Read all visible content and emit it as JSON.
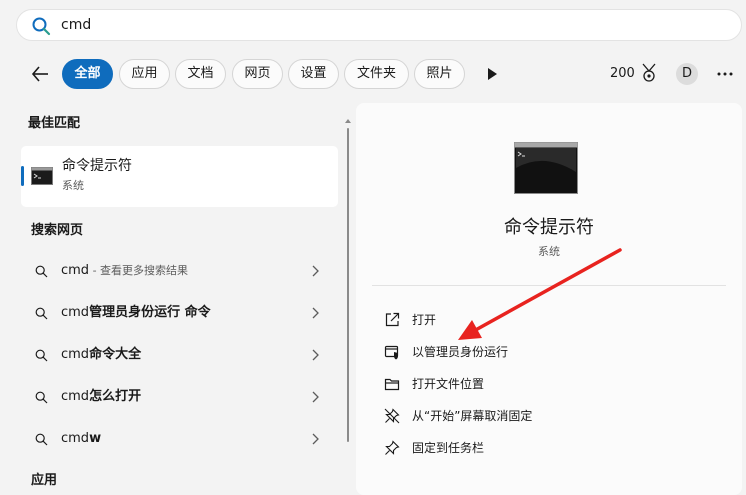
{
  "search": {
    "query": "cmd"
  },
  "filters": {
    "tabs": [
      {
        "label": "全部",
        "active": true
      },
      {
        "label": "应用"
      },
      {
        "label": "文档"
      },
      {
        "label": "网页"
      },
      {
        "label": "设置"
      },
      {
        "label": "文件夹"
      },
      {
        "label": "照片"
      }
    ],
    "points": "200",
    "avatar_letter": "D"
  },
  "results": {
    "best_match_header": "最佳匹配",
    "best_match": {
      "title": "命令提示符",
      "subtitle": "系统",
      "icon": "command-prompt-icon"
    },
    "web_header": "搜索网页",
    "web_items": [
      {
        "main": "cmd",
        "hint": " - 查看更多搜索结果"
      },
      {
        "main": "cmd",
        "bold": "管理员身份运行 命令"
      },
      {
        "main": "cmd",
        "bold": "命令大全"
      },
      {
        "main": "cmd",
        "bold": "怎么打开"
      },
      {
        "main": "cmd",
        "bold": "w"
      }
    ],
    "apps_header": "应用"
  },
  "detail": {
    "title": "命令提示符",
    "subtitle": "系统",
    "actions": [
      {
        "label": "打开",
        "icon": "open-external-icon"
      },
      {
        "label": "以管理员身份运行",
        "icon": "shield-icon"
      },
      {
        "label": "打开文件位置",
        "icon": "folder-icon"
      },
      {
        "label": "从“开始”屏幕取消固定",
        "icon": "unpin-icon"
      },
      {
        "label": "固定到任务栏",
        "icon": "pin-icon"
      }
    ]
  },
  "colors": {
    "accent": "#0f6cbd",
    "annotation_arrow": "#e8231f",
    "background": "#f3f3f3"
  }
}
